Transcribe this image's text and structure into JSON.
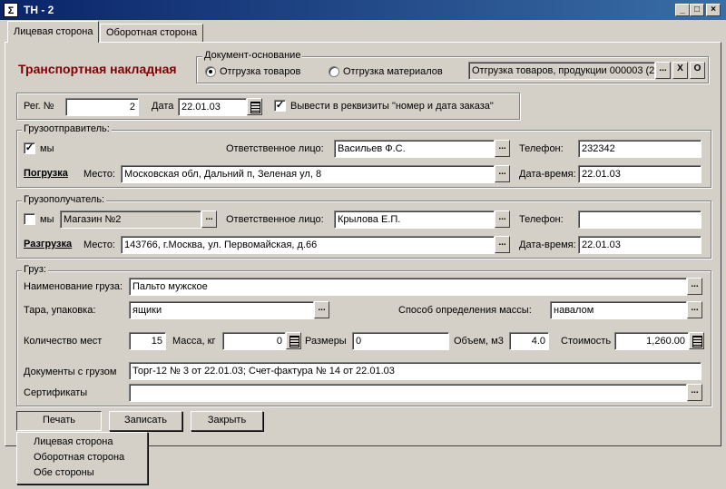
{
  "window": {
    "title": "ТН - 2",
    "icon": "document-icon"
  },
  "tabs": [
    {
      "label": "Лицевая сторона",
      "active": true
    },
    {
      "label": "Оборотная сторона",
      "active": false
    }
  ],
  "doc_title": "Транспортная накладная",
  "basis": {
    "legend": "Документ-основание",
    "radio_goods": "Отгрузка товаров",
    "radio_materials": "Отгрузка материалов",
    "selected": "goods",
    "value": "Отгрузка товаров, продукции 000003 (2",
    "btn_select": "...",
    "btn_clear": "X",
    "btn_open": "O"
  },
  "reg": {
    "label": "Рег. №",
    "value": "2",
    "date_label": "Дата",
    "date_value": "22.01.03",
    "order_checkbox_label": "Вывести в реквизиты \"номер и дата заказа\"",
    "order_checked": true
  },
  "shipper": {
    "legend": "Грузоотправитель:",
    "we_label": "мы",
    "we_checked": true,
    "responsible_label": "Ответственное лицо:",
    "responsible_value": "Васильев Ф.С.",
    "phone_label": "Телефон:",
    "phone_value": "232342",
    "action_label": "Погрузка",
    "place_label": "Место:",
    "place_value": "Московская обл, Дальний п, Зеленая ул, 8",
    "datetime_label": "Дата-время:",
    "datetime_value": "22.01.03"
  },
  "consignee": {
    "legend": "Грузополучатель:",
    "we_label": "мы",
    "we_checked": false,
    "name_value": "Магазин №2",
    "responsible_label": "Ответственное лицо:",
    "responsible_value": "Крылова Е.П.",
    "phone_label": "Телефон:",
    "phone_value": "",
    "action_label": "Разгрузка",
    "place_label": "Место:",
    "place_value": "143766, г.Москва, ул. Первомайская, д.66",
    "datetime_label": "Дата-время:",
    "datetime_value": "22.01.03"
  },
  "cargo": {
    "legend": "Груз:",
    "name_label": "Наименование груза:",
    "name_value": "Пальто мужское",
    "package_label": "Тара, упаковка:",
    "package_value": "ящики",
    "mass_method_label": "Способ определения массы:",
    "mass_method_value": "навалом",
    "places_label": "Количество мест",
    "places_value": "15",
    "mass_label": "Масса, кг",
    "mass_value": "0",
    "size_label": "Размеры",
    "size_value": "0",
    "volume_label": "Объем, м3",
    "volume_value": "4.0",
    "cost_label": "Стоимость",
    "cost_value": "1,260.00",
    "docs_label": "Документы с грузом",
    "docs_value": "Торг-12 № 3 от 22.01.03; Счет-фактура № 14 от 22.01.03",
    "certs_label": "Сертификаты",
    "certs_value": ""
  },
  "buttons": {
    "print": "Печать",
    "write": "Записать",
    "close": "Закрыть"
  },
  "print_menu": [
    "Лицевая сторона",
    "Оборотная сторона",
    "Обе стороны"
  ]
}
